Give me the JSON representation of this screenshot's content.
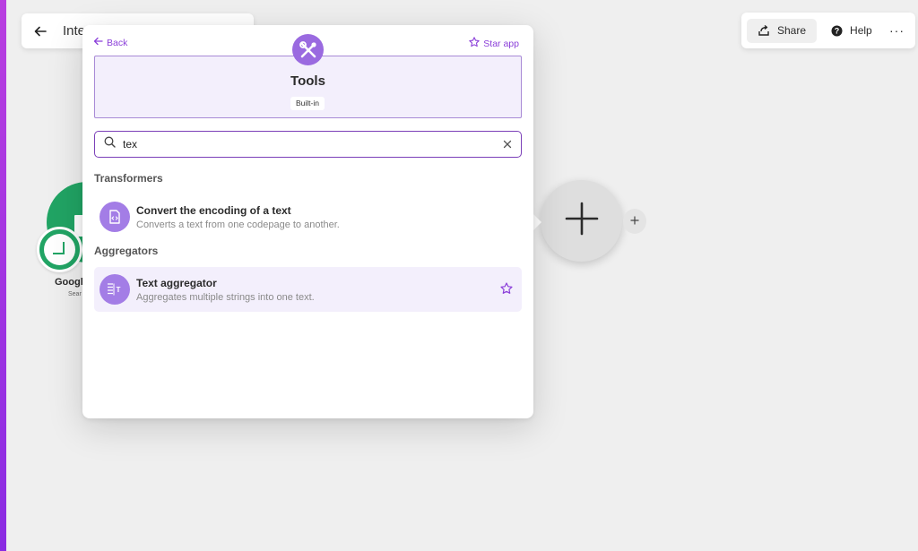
{
  "scenario": {
    "title": "Inte"
  },
  "toolbar": {
    "share_label": "Share",
    "help_label": "Help",
    "more_label": "···"
  },
  "background_module": {
    "label": "Googl",
    "sublabel": "Sear",
    "color": "#21a464"
  },
  "popup": {
    "back_label": "Back",
    "star_label": "Star app",
    "app_title": "Tools",
    "app_badge": "Built-in",
    "search": {
      "value": "tex",
      "placeholder": ""
    },
    "sections": [
      {
        "title": "Transformers",
        "items": [
          {
            "title": "Convert the encoding of a text",
            "description": "Converts a text from one codepage to another.",
            "icon": "code-file-icon"
          }
        ]
      },
      {
        "title": "Aggregators",
        "items": [
          {
            "title": "Text aggregator",
            "description": "Aggregates multiple strings into one text.",
            "icon": "text-aggregator-icon"
          }
        ]
      }
    ]
  },
  "colors": {
    "accent": "#8b3fd9",
    "icon_bg": "#a37de6",
    "header_bg": "#f3effc"
  }
}
